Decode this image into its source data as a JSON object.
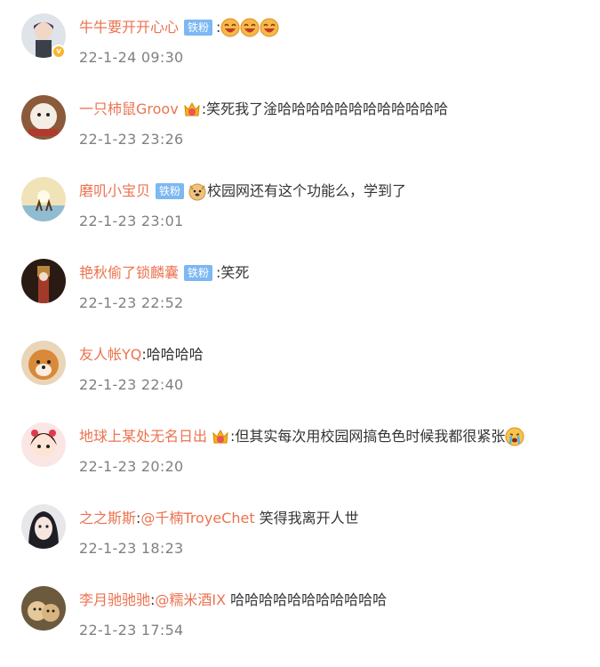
{
  "comments": [
    {
      "name": "牛牛要开开心心",
      "fan": "铁粉",
      "colon": ":",
      "text": "",
      "time": "22-1-24 09:30",
      "emotes": [
        "laugh-emoji",
        "laugh-emoji",
        "laugh-emoji"
      ],
      "verified": true
    },
    {
      "name": "一只柿鼠Groov",
      "colon": ":",
      "text": "笑死我了淦哈哈哈哈哈哈哈哈哈哈哈哈",
      "time": "22-1-23 23:26",
      "emotes": [
        "crown-emoji"
      ]
    },
    {
      "name": "磨叽小宝贝",
      "fan": "铁粉",
      "colon": "",
      "text": "校园网还有这个功能么，学到了",
      "time": "22-1-23 23:01",
      "emotes": [
        "doge-emoji"
      ]
    },
    {
      "name": "艳秋偷了锁麟囊",
      "fan": "铁粉",
      "colon": ":",
      "text": "笑死",
      "time": "22-1-23 22:52"
    },
    {
      "name": "友人帐YQ",
      "colon": ":",
      "text": "哈哈哈哈",
      "time": "22-1-23 22:40"
    },
    {
      "name": "地球上某处无名日出",
      "colon": ":",
      "text": "但其实每次用校园网搞色色时候我都很紧张",
      "time": "22-1-23 20:20",
      "emotes": [
        "crown-emoji",
        "crying-emoji"
      ]
    },
    {
      "name": "之之斯斯",
      "colon": ":",
      "mention": "@千楠TroyeChet",
      "text": " 笑得我离开人世",
      "time": "22-1-23 18:23"
    },
    {
      "name": "李月驰驰驰",
      "colon": ":",
      "mention": "@糯米酒IX",
      "text": " 哈哈哈哈哈哈哈哈哈哈哈",
      "time": "22-1-23 17:54"
    }
  ],
  "colors": {
    "username": "#eb7350",
    "fan_badge": "#7cb8f2",
    "timestamp": "#808080",
    "text": "#333333"
  }
}
